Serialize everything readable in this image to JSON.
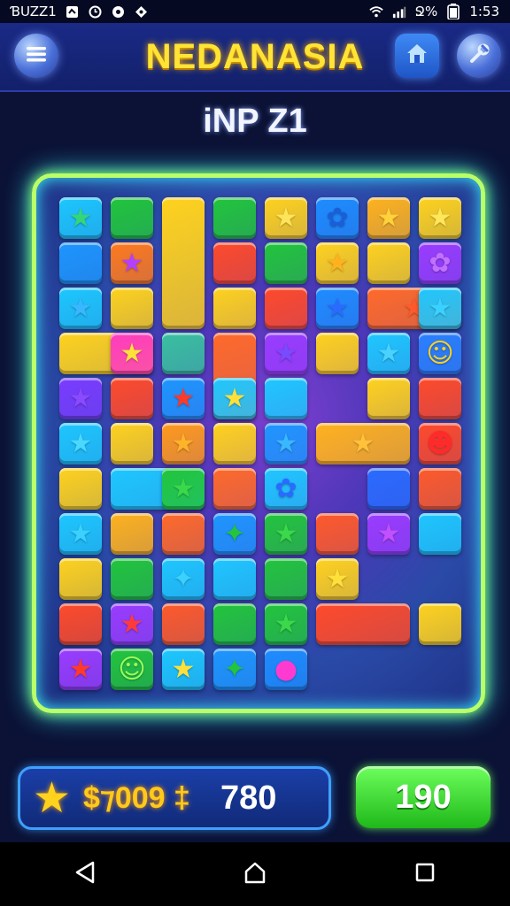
{
  "status_bar": {
    "carrier": "ƁUZZ1",
    "battery_text": "Ջ%",
    "time": "1:53",
    "icons": [
      "notification-icon",
      "clock-icon",
      "media-icon",
      "location-icon",
      "wifi-icon",
      "signal-icon",
      "battery-icon"
    ]
  },
  "header": {
    "title": "NEDANASIA",
    "menu_icon": "hamburger-icon",
    "home_icon": "house-icon",
    "settings_icon": "wrench-icon"
  },
  "level": {
    "label": "iNP Z1"
  },
  "board": {
    "tiles": [
      {
        "color": "#1ec7ff",
        "glyph": "★",
        "glyph_color": "#35d57a"
      },
      {
        "color": "#22c53c",
        "glyph": ""
      },
      {
        "color": "#ffd21e",
        "glyph": ""
      },
      {
        "color": "#22c53c",
        "glyph": ""
      },
      {
        "color": "#ffd21e",
        "glyph": "★",
        "glyph_color": "#ffe45a"
      },
      {
        "color": "#1e8cff",
        "glyph": "✿",
        "glyph_color": "#1a5fd8"
      },
      {
        "color": "#ffb21e",
        "glyph": "★",
        "glyph_color": "#ffd13a"
      },
      {
        "color": "#ffd21e",
        "glyph": "★",
        "glyph_color": "#ffe65a"
      },
      {
        "color": "#1e96ff",
        "glyph": ""
      },
      {
        "color": "#ff7a1e",
        "glyph": "★",
        "glyph_color": "#b340ff"
      },
      {
        "color": "#ff4a2a",
        "glyph": ""
      },
      {
        "color": "#22c53c",
        "glyph": ""
      },
      {
        "color": "#ffd21e",
        "glyph": "★",
        "glyph_color": "#ffb21e"
      },
      {
        "color": "#ffd21e",
        "glyph": ""
      },
      {
        "color": "#9a3cff",
        "glyph": "✿",
        "glyph_color": "#c270ff"
      },
      {
        "color": "#1ec7ff",
        "glyph": "★",
        "glyph_color": "#39b8ff"
      },
      {
        "color": "#ffd21e",
        "glyph": ""
      },
      {
        "color": "#ffd21e",
        "glyph": ""
      },
      {
        "color": "#ff4a2a",
        "glyph": ""
      },
      {
        "color": "#1e8cff",
        "glyph": "★",
        "glyph_color": "#2a6bff"
      },
      {
        "color": "#ff6a2a",
        "glyph": "★",
        "glyph_color": "#ff5a2a"
      },
      {
        "color": "#1ec7ff",
        "glyph": "★",
        "glyph_color": "#3ad1ff"
      },
      {
        "color": "#ffd21e",
        "glyph": ""
      },
      {
        "color": "#ff3ac0",
        "glyph": "★",
        "glyph_color": "#ffe03a"
      },
      {
        "color": "#3ac0a0",
        "glyph": ""
      },
      {
        "color": "#ff6a2a",
        "glyph": ""
      },
      {
        "color": "#9a3cff",
        "glyph": "★",
        "glyph_color": "#7a4aff"
      },
      {
        "color": "#ffd21e",
        "glyph": ""
      },
      {
        "color": "#1ec7ff",
        "glyph": "★",
        "glyph_color": "#4ad2ff"
      },
      {
        "color": "#2a80ff",
        "glyph": "☺",
        "glyph_color": "#ffd21e"
      },
      {
        "color": "#7a3cff",
        "glyph": "★",
        "glyph_color": "#8a4aff"
      },
      {
        "color": "#ff4a2a",
        "glyph": ""
      },
      {
        "color": "#1e96ff",
        "glyph": "★",
        "glyph_color": "#ff3a2a"
      },
      {
        "color": "#1ec7ff",
        "glyph": "★",
        "glyph_color": "#ffe03a"
      },
      {
        "color": "#1ec7ff",
        "glyph": ""
      },
      {
        "color": "#ffd21e",
        "glyph": ""
      },
      {
        "color": "#ff4a2a",
        "glyph": ""
      },
      {
        "color": "#1ec7ff",
        "glyph": "★",
        "glyph_color": "#4ad8ff"
      },
      {
        "color": "#ffd21e",
        "glyph": ""
      },
      {
        "color": "#ff9a1e",
        "glyph": "★",
        "glyph_color": "#ffb32a"
      },
      {
        "color": "#ffd21e",
        "glyph": ""
      },
      {
        "color": "#1e96ff",
        "glyph": "★",
        "glyph_color": "#3ab8ff"
      },
      {
        "color": "#ffb21e",
        "glyph": "★",
        "glyph_color": "#ffc23a"
      },
      {
        "color": "#ff4a2a",
        "glyph": "☻",
        "glyph_color": "#ff2a2a"
      },
      {
        "color": "#ffd21e",
        "glyph": ""
      },
      {
        "color": "#1ec7ff",
        "glyph": ""
      },
      {
        "color": "#22c53c",
        "glyph": "★",
        "glyph_color": "#3ad84a"
      },
      {
        "color": "#ff6a2a",
        "glyph": ""
      },
      {
        "color": "#1ec7ff",
        "glyph": "✿",
        "glyph_color": "#2a6bff"
      },
      {
        "color": "#2a6bff",
        "glyph": ""
      },
      {
        "color": "#ff5a2a",
        "glyph": ""
      },
      {
        "color": "#1ec7ff",
        "glyph": "★",
        "glyph_color": "#3ad1ff"
      },
      {
        "color": "#ffb21e",
        "glyph": ""
      },
      {
        "color": "#ff6a2a",
        "glyph": ""
      },
      {
        "color": "#1e96ff",
        "glyph": "✦",
        "glyph_color": "#22c53c"
      },
      {
        "color": "#22c53c",
        "glyph": "★",
        "glyph_color": "#3ad84a"
      },
      {
        "color": "#ff5a2a",
        "glyph": ""
      },
      {
        "color": "#9a3cff",
        "glyph": "★",
        "glyph_color": "#c250ff"
      },
      {
        "color": "#1ec7ff",
        "glyph": ""
      },
      {
        "color": "#ffd21e",
        "glyph": ""
      },
      {
        "color": "#22c53c",
        "glyph": ""
      },
      {
        "color": "#1ec7ff",
        "glyph": "✦",
        "glyph_color": "#3ad1ff"
      },
      {
        "color": "#1ec7ff",
        "glyph": ""
      },
      {
        "color": "#22c53c",
        "glyph": ""
      },
      {
        "color": "#ffd21e",
        "glyph": "★",
        "glyph_color": "#ffe03a"
      },
      {
        "color": "#ff4a2a",
        "glyph": ""
      },
      {
        "color": "#9a3cff",
        "glyph": "★",
        "glyph_color": "#ff3a3a"
      },
      {
        "color": "#ff5a2a",
        "glyph": ""
      },
      {
        "color": "#22c53c",
        "glyph": ""
      },
      {
        "color": "#22c53c",
        "glyph": "★",
        "glyph_color": "#3ad84a"
      },
      {
        "color": "#ff4a2a",
        "glyph": ""
      },
      {
        "color": "#ffd21e",
        "glyph": ""
      },
      {
        "color": "#9a3cff",
        "glyph": "★",
        "glyph_color": "#ff3a2a"
      },
      {
        "color": "#22c53c",
        "glyph": "☺",
        "glyph_color": "#9aff5a"
      },
      {
        "color": "#1ec7ff",
        "glyph": "★",
        "glyph_color": "#ffe03a"
      },
      {
        "color": "#1e96ff",
        "glyph": "✦",
        "glyph_color": "#22c53c"
      },
      {
        "color": "#1e8cff",
        "glyph": "●",
        "glyph_color": "#ff3ad0"
      }
    ]
  },
  "score": {
    "star_icon": "star-icon",
    "value": "$⁊009 ‡",
    "count": "780"
  },
  "play_button": {
    "label": "190"
  },
  "nav": {
    "back_icon": "back-icon",
    "home_icon": "home-icon",
    "recents_icon": "recents-icon"
  },
  "colors": {
    "frame_glow": "#b8ff6a",
    "title": "#ffe436",
    "score_text": "#ffc91a",
    "play_green": "#3ad82a"
  }
}
